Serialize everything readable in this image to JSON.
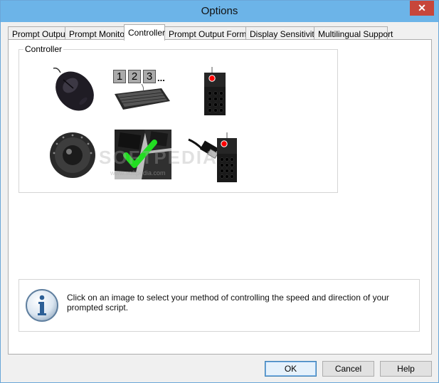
{
  "window": {
    "title": "Options",
    "close_glyph": "✕"
  },
  "tabs": [
    {
      "label": "Prompt Output",
      "active": false
    },
    {
      "label": "Prompt Monitor",
      "active": false
    },
    {
      "label": "Controller",
      "active": true
    },
    {
      "label": "Prompt Output Format",
      "active": false
    },
    {
      "label": "Display Sensitivity",
      "active": false
    },
    {
      "label": "Multilingual Support",
      "active": false
    }
  ],
  "controller_group": {
    "label": "Controller",
    "options": [
      {
        "name": "mouse",
        "icon": "mouse-icon",
        "selected": false
      },
      {
        "name": "keyboard",
        "icon": "keyboard-icon",
        "digits": [
          "1",
          "2",
          "3"
        ],
        "ellipsis": "...",
        "selected": false
      },
      {
        "name": "remote",
        "icon": "remote-icon",
        "selected": false
      },
      {
        "name": "trackball",
        "icon": "trackball-icon",
        "selected": false
      },
      {
        "name": "keyboard-keys",
        "icon": "keyboard-keys-icon",
        "selected": true
      },
      {
        "name": "usb-remote",
        "icon": "usb-remote-icon",
        "selected": false
      }
    ]
  },
  "watermark": {
    "text": "SOFTPEDIA",
    "url": "www.softpedia.com"
  },
  "info": {
    "icon": "info-icon",
    "message": "Click on an image to select your method of controlling the speed and direction of your prompted script."
  },
  "buttons": {
    "ok": "OK",
    "cancel": "Cancel",
    "help": "Help"
  },
  "colors": {
    "titlebar": "#6cb4e8",
    "close": "#c7463b",
    "check": "#22dd22",
    "remote_button": "#ff0000"
  }
}
